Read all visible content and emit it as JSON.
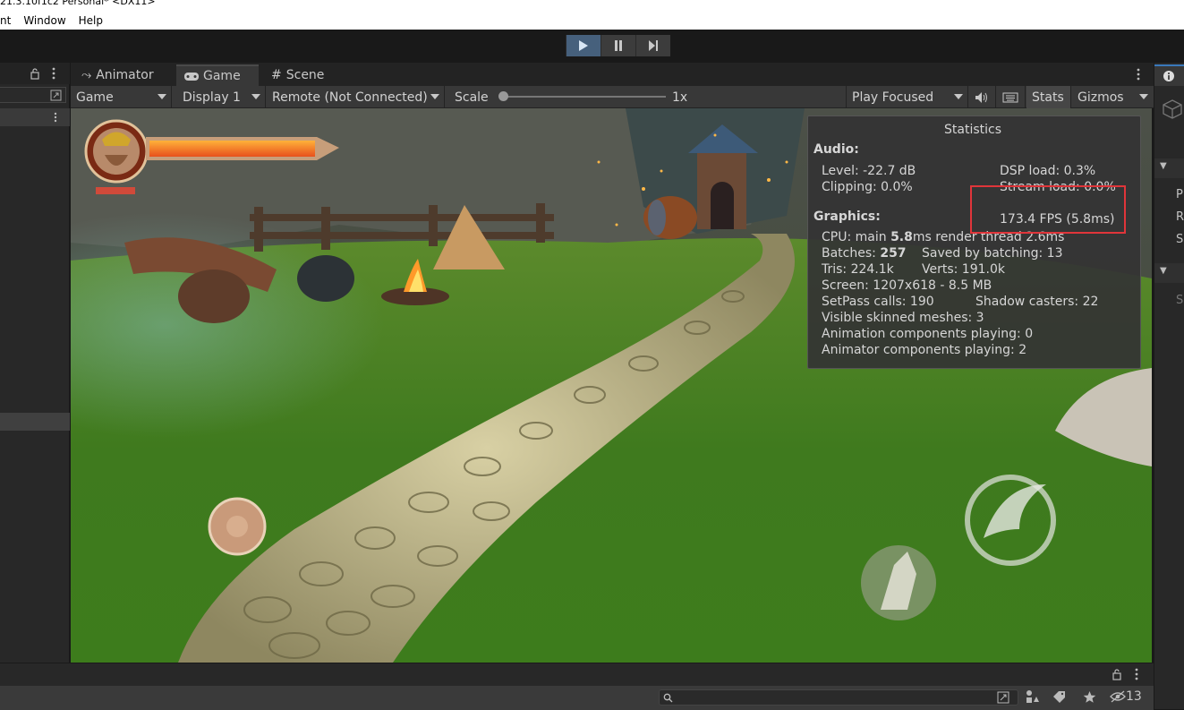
{
  "window": {
    "title": "21.3.10f1c2 Personal* <DX11>"
  },
  "menu": {
    "items": [
      "nt",
      "Window",
      "Help"
    ]
  },
  "tabs": [
    {
      "label": "Animator",
      "icon": "animator-icon"
    },
    {
      "label": "Game",
      "icon": "gamepad-icon"
    },
    {
      "label": "Scene",
      "icon": "grid-icon"
    }
  ],
  "game_toolbar": {
    "mode": "Game",
    "display": "Display 1",
    "remote": "Remote (Not Connected)",
    "scale_label": "Scale",
    "scale_value": "1x",
    "play_mode": "Play Focused",
    "stats": "Stats",
    "gizmos": "Gizmos"
  },
  "statistics": {
    "title": "Statistics",
    "audio_header": "Audio:",
    "level": "Level: -22.7 dB",
    "dsp_load": "DSP load: 0.3%",
    "clipping": "Clipping: 0.0%",
    "stream_load": "Stream load: 0.0%",
    "graphics_header": "Graphics:",
    "fps": "173.4 FPS (5.8ms)",
    "cpu_prefix": "CPU: main ",
    "cpu_main_value": "5.8",
    "cpu_suffix": "ms  render thread 2.6ms",
    "batches_prefix": "Batches: ",
    "batches_value": "257",
    "saved_by_batching": "Saved by batching: 13",
    "tris": "Tris: 224.1k",
    "verts": "Verts: 191.0k",
    "screen": "Screen: 1207x618 - 8.5 MB",
    "setpass": "SetPass calls: 190",
    "shadow_casters": "Shadow casters: 22",
    "visible_skinned": "Visible skinned meshes: 3",
    "animation_components": "Animation components playing: 0",
    "animator_components": "Animator components playing: 2"
  },
  "right_panel": {
    "letters": [
      "P",
      "R",
      "S",
      "S"
    ]
  },
  "bottom_panel": {
    "hidden_count": "13"
  }
}
